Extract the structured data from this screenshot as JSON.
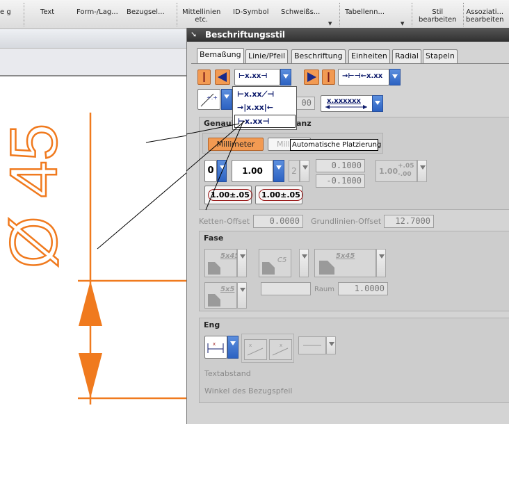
{
  "ribbon": {
    "items": [
      {
        "label": "e\ng"
      },
      {
        "label": "Text"
      },
      {
        "label": "Form-/Lag..."
      },
      {
        "label": "Bezugsel..."
      },
      {
        "label": "Mittellinien\netc."
      },
      {
        "label": "ID-Symbol"
      },
      {
        "label": "Schweißs..."
      },
      {
        "label": "Tabellenn..."
      },
      {
        "label": "Stil\nbearbeiten"
      },
      {
        "label": "Assoziati...\nbearbeiten"
      }
    ]
  },
  "drawing": {
    "dimension_text": "Ø 45",
    "line_color": "#f07a1e"
  },
  "dialog": {
    "title": "Beschriftungsstil",
    "tabs": [
      "Bemaßung",
      "Linie/Pfeil",
      "Beschriftung",
      "Einheiten",
      "Radial",
      "Stapeln"
    ],
    "active_tab": "Bemaßung",
    "placement_value": "⊢x.xx⊣",
    "text_orientation_value": "→⊢⊣←x.xx",
    "tolerance_placement_value": "x.xxxxxx",
    "popup": {
      "items": [
        "⊢x.xx⟋⊣",
        "→|x.xx|←",
        "⊢x.xx⊣"
      ]
    },
    "tooltip": "Automatische Platzierung",
    "precision_group": {
      "title": "Genauigkeit und Toleranz",
      "title_visible_left": "Genaui",
      "title_visible_right": "anz",
      "millimeter_label": "Millimeter",
      "milli_partial_label": "Milli",
      "precision_value": "0",
      "value_field": "1.00",
      "tol_precision": "2",
      "upper_tol": "0.1000",
      "lower_tol": "-0.1000",
      "tol_preview": "1.00",
      "tol_preview_upper": "+.05",
      "tol_preview_lower": "-.00",
      "style_btn_1": "1.00±.05",
      "style_btn_2": "1.00±.05",
      "hidden_field": "00"
    },
    "ketten_offset": {
      "label": "Ketten-Offset",
      "value": "0.0000"
    },
    "grundlinien_offset": {
      "label": "Grundlinien-Offset",
      "value": "12.7000"
    },
    "fase": {
      "title": "Fase",
      "option1": "5x45",
      "option2": "C5",
      "option3": "5x45",
      "option4": "5x5",
      "raum_label": "Raum",
      "raum_value": "1.0000"
    },
    "eng": {
      "title": "Eng",
      "textabstand_label": "Textabstand",
      "winkel_label": "Winkel des Bezugspfeil"
    }
  },
  "colors": {
    "accent_orange": "#f29a52",
    "dropdown_blue": "#2c62c2",
    "title_bar": "#303030"
  }
}
